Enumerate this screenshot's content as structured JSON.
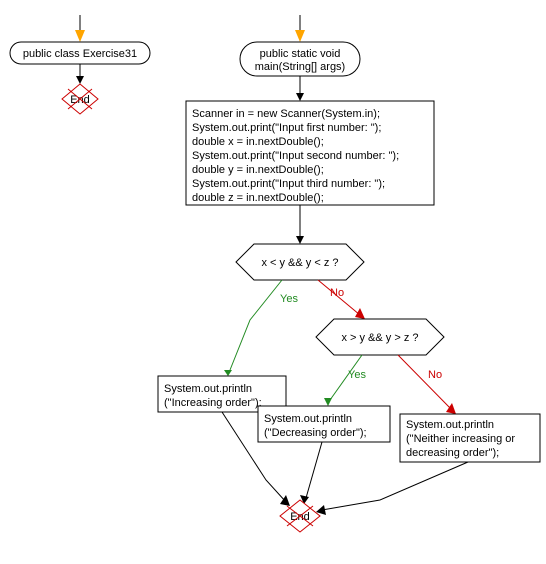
{
  "left_flow": {
    "header": "public class Exercise31",
    "end": "End"
  },
  "right_flow": {
    "header_line1": "public static void",
    "header_line2": "main(String[] args)",
    "code": {
      "line1": "Scanner in = new Scanner(System.in);",
      "line2": "System.out.print(\"Input first number: \");",
      "line3": "double x = in.nextDouble();",
      "line4": "System.out.print(\"Input second number: \");",
      "line5": "double y = in.nextDouble();",
      "line6": "System.out.print(\"Input third number: \");",
      "line7": "double z = in.nextDouble();"
    },
    "decision1": "x < y && y < z ?",
    "decision2": "x > y && y > z ?",
    "out_increasing_line1": "System.out.println",
    "out_increasing_line2": "(\"Increasing order\");",
    "out_decreasing_line1": "System.out.println",
    "out_decreasing_line2": "(\"Decreasing order\");",
    "out_neither_line1": "System.out.println",
    "out_neither_line2": "(\"Neither increasing or",
    "out_neither_line3": "decreasing order\");",
    "label_yes": "Yes",
    "label_no": "No",
    "end": "End"
  }
}
